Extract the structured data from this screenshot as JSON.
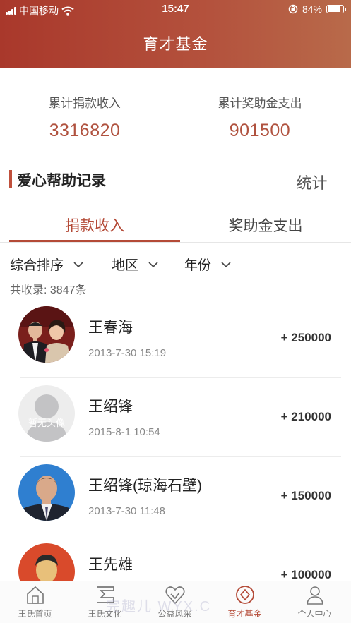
{
  "status_bar": {
    "carrier": "中国移动",
    "time": "15:47",
    "battery": "84%",
    "battery_level": 0.84
  },
  "header": {
    "title": "育才基金"
  },
  "stats": {
    "income_label": "累计捐款收入",
    "income_value": "3316820",
    "expense_label": "累计奖助金支出",
    "expense_value": "901500"
  },
  "section": {
    "title": "爱心帮助记录",
    "stats_button": "统计"
  },
  "tabs": [
    {
      "label": "捐款收入",
      "active": true
    },
    {
      "label": "奖助金支出",
      "active": false
    }
  ],
  "filters": [
    {
      "label": "综合排序"
    },
    {
      "label": "地区"
    },
    {
      "label": "年份"
    }
  ],
  "total_text": "共收录: 3847条",
  "records": [
    {
      "name": "王春海",
      "time": "2013-7-30 15:19",
      "amount": "+ 250000",
      "avatar": "photo-couple"
    },
    {
      "name": "王绍锋",
      "time": "2015-8-1 10:54",
      "amount": "+ 210000",
      "avatar": "placeholder",
      "avatar_text": "暂无头像"
    },
    {
      "name": "王绍锋(琼海石壁)",
      "time": "2013-7-30 11:48",
      "amount": "+ 150000",
      "avatar": "photo-man-blue"
    },
    {
      "name": "王先雄",
      "time": "",
      "amount": "+ 100000",
      "avatar": "photo-man-red"
    }
  ],
  "tabbar": [
    {
      "label": "王氏首页",
      "icon": "home-icon",
      "active": false
    },
    {
      "label": "王氏文化",
      "icon": "culture-icon",
      "active": false
    },
    {
      "label": "公益风采",
      "icon": "charity-heart-icon",
      "active": false
    },
    {
      "label": "育才基金",
      "icon": "fund-icon",
      "active": true
    },
    {
      "label": "个人中心",
      "icon": "user-icon",
      "active": false
    }
  ],
  "watermark": "完趣儿 WYX.C",
  "colors": {
    "accent": "#b44a37",
    "header_start": "#a9382b",
    "header_end": "#b86a4a",
    "value_color": "#b0523f"
  }
}
